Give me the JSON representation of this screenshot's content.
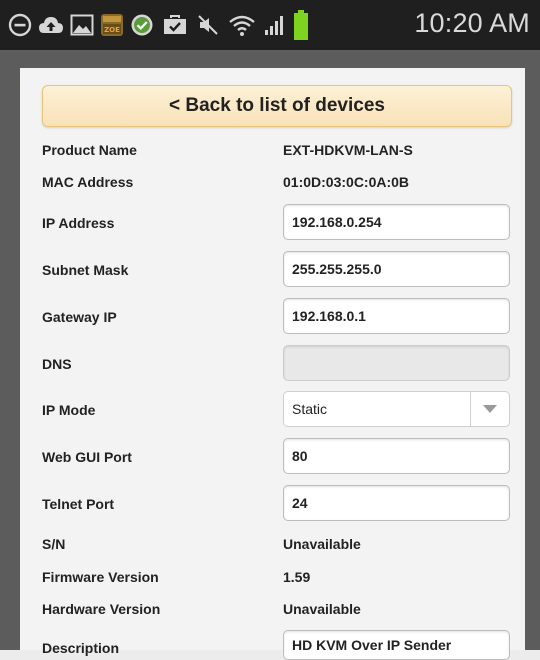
{
  "status_bar": {
    "time": "10:20 AM",
    "icons": [
      "minus-circle-icon",
      "cloud-upload-icon",
      "image-icon",
      "zoe-app-icon",
      "check-circle-icon",
      "briefcase-check-icon",
      "mute-icon",
      "wifi-icon",
      "signal-icon",
      "battery-icon"
    ]
  },
  "back_button": {
    "label": "< Back to list of devices"
  },
  "fields": {
    "product_name": {
      "label": "Product Name",
      "value": "EXT-HDKVM-LAN-S"
    },
    "mac_address": {
      "label": "MAC Address",
      "value": "01:0D:03:0C:0A:0B"
    },
    "ip_address": {
      "label": "IP Address",
      "value": "192.168.0.254"
    },
    "subnet_mask": {
      "label": "Subnet Mask",
      "value": "255.255.255.0"
    },
    "gateway_ip": {
      "label": "Gateway IP",
      "value": "192.168.0.1"
    },
    "dns": {
      "label": "DNS",
      "value": ""
    },
    "ip_mode": {
      "label": "IP Mode",
      "value": "Static"
    },
    "web_gui_port": {
      "label": "Web GUI Port",
      "value": "80"
    },
    "telnet_port": {
      "label": "Telnet Port",
      "value": "24"
    },
    "serial_number": {
      "label": "S/N",
      "value": "Unavailable"
    },
    "firmware_version": {
      "label": "Firmware Version",
      "value": "1.59"
    },
    "hardware_version": {
      "label": "Hardware Version",
      "value": "Unavailable"
    },
    "description": {
      "label": "Description",
      "value": "HD KVM Over IP Sender"
    }
  },
  "colors": {
    "status_bar_bg": "#1f1f1f",
    "frame": "#5c5c5c",
    "panel": "#f3f3f3",
    "back_button_bg": "#fbe9c6",
    "battery": "#7ed321"
  }
}
